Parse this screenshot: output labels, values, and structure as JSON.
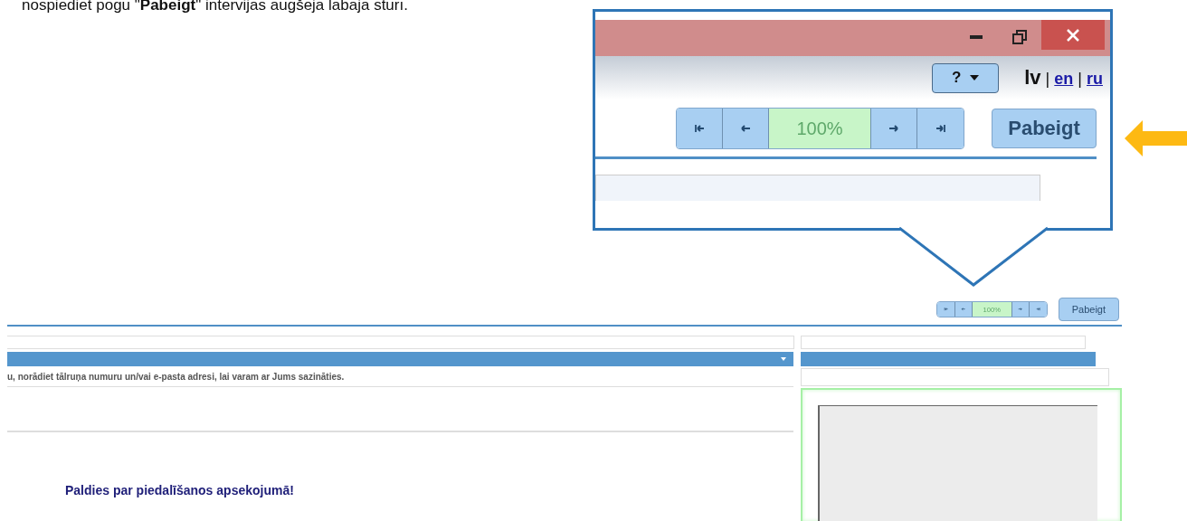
{
  "instruction": "nospiediet pogu \"**Pabeigt**\" intervijas augšējā labajā stūrī.",
  "zoom_callout": {
    "help_button": {
      "label": "?"
    },
    "languages": [
      {
        "label": "lv",
        "selected": true
      },
      {
        "label": "en",
        "selected": false
      },
      {
        "label": "ru",
        "selected": false
      }
    ],
    "language_separators": [
      "|",
      "|"
    ],
    "progress": {
      "label": "100%",
      "level": 1
    },
    "finish_button": "Pabeigt"
  },
  "survey": {
    "progress": {
      "label": "100%",
      "level": 1
    },
    "finish_button": "Pabeigt",
    "question_text": "u, norādiet tālruņa numuru un/vai e-pasta adresi, lai varam ar Jums sazināties.",
    "thanks": "Paldies par piedalīšanos apsekojumā!"
  }
}
